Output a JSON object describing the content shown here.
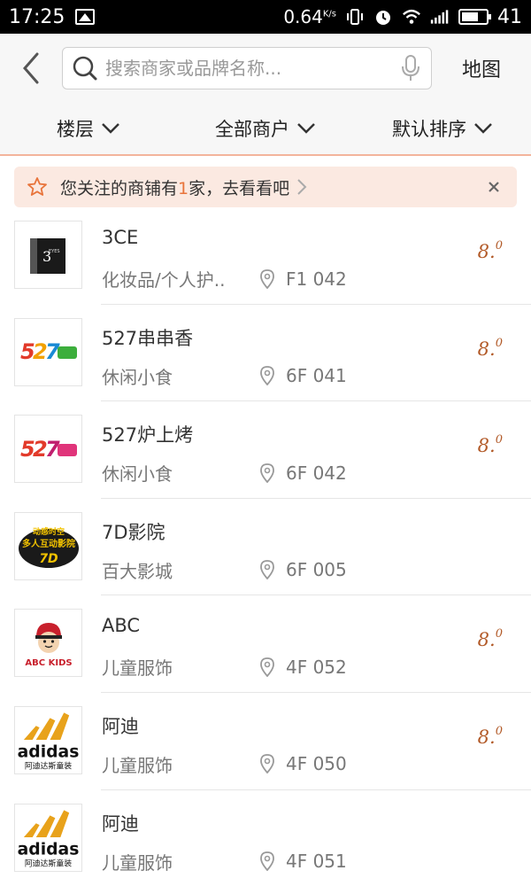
{
  "status_bar": {
    "time": "17:25",
    "speed": "0.64",
    "speed_unit": "K/s",
    "battery": "41"
  },
  "header": {
    "search_placeholder": "搜索商家或品牌名称...",
    "map_label": "地图"
  },
  "filters": [
    {
      "label": "楼层"
    },
    {
      "label": "全部商户"
    },
    {
      "label": "默认排序"
    }
  ],
  "follow_banner": {
    "prefix": "您关注的商铺有",
    "count": "1",
    "suffix": "家，去看看吧"
  },
  "stores": [
    {
      "name": "3CE",
      "category": "化妆品/个人护..",
      "floor": "F1 042",
      "rating_int": "8.",
      "rating_dec": "0",
      "logo": "3ce-logo"
    },
    {
      "name": "527串串香",
      "category": "休闲小食",
      "floor": "6F 041",
      "rating_int": "8.",
      "rating_dec": "0",
      "logo": "527-logo"
    },
    {
      "name": "527炉上烤",
      "category": "休闲小食",
      "floor": "6F 042",
      "rating_int": "8.",
      "rating_dec": "0",
      "logo": "527-logo"
    },
    {
      "name": "7D影院",
      "category": "百大影城",
      "floor": "6F 005",
      "rating_int": "",
      "rating_dec": "",
      "logo": "7d-logo"
    },
    {
      "name": "ABC",
      "category": "儿童服饰",
      "floor": "4F 052",
      "rating_int": "8.",
      "rating_dec": "0",
      "logo": "abc-kids-logo"
    },
    {
      "name": "阿迪",
      "category": "儿童服饰",
      "floor": "4F 050",
      "rating_int": "8.",
      "rating_dec": "0",
      "logo": "adidas-logo"
    },
    {
      "name": "阿迪",
      "category": "儿童服饰",
      "floor": "4F 051",
      "rating_int": "",
      "rating_dec": "",
      "logo": "adidas-logo"
    }
  ],
  "logo_text": {
    "abc_kids": "ABC KIDS",
    "adidas": "adidas",
    "adidas_sub": "阿迪达斯童装",
    "d7": "7D",
    "d7_top": "动感时空",
    "d7_mid": "多人互动影院"
  },
  "colors": {
    "accent": "#e8743b",
    "rating": "#b25a28",
    "banner_bg": "#fbe9e1"
  }
}
